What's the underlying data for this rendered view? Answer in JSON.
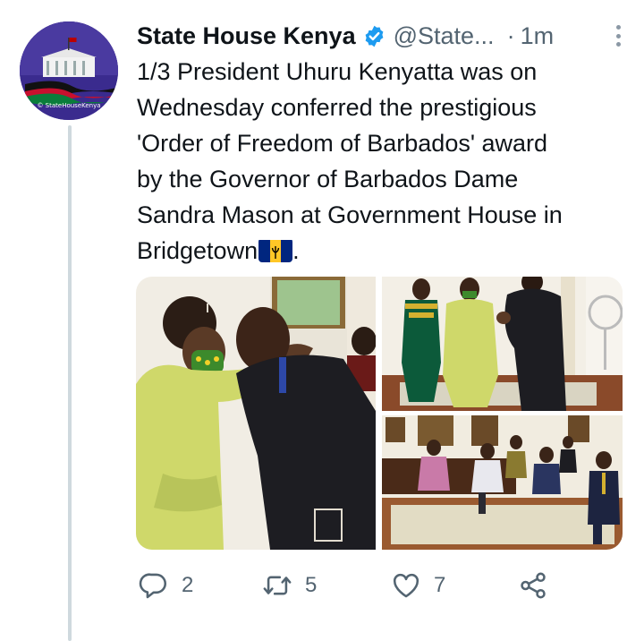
{
  "tweet": {
    "display_name": "State House Kenya",
    "handle": "@State...",
    "separator": "·",
    "time": "1m",
    "verified": true,
    "avatar_caption": "© StateHouseKenya",
    "text_lines": [
      "1/3 President Uhuru Kenyatta was on",
      "Wednesday conferred the prestigious",
      "'Order of Freedom of Barbados' award",
      "by the Governor of Barbados Dame",
      "Sandra Mason at Government House in",
      "Bridgetown"
    ],
    "text_end": ".",
    "emoji": "barbados-flag",
    "media_count": 3
  },
  "actions": {
    "reply_count": "2",
    "retweet_count": "5",
    "like_count": "7"
  },
  "colors": {
    "primary_text": "#0f1419",
    "secondary_text": "#536471",
    "verified_blue": "#1d9bf0",
    "thread_line": "#cfd9de",
    "flag_blue": "#00267f",
    "flag_gold": "#ffc726"
  }
}
